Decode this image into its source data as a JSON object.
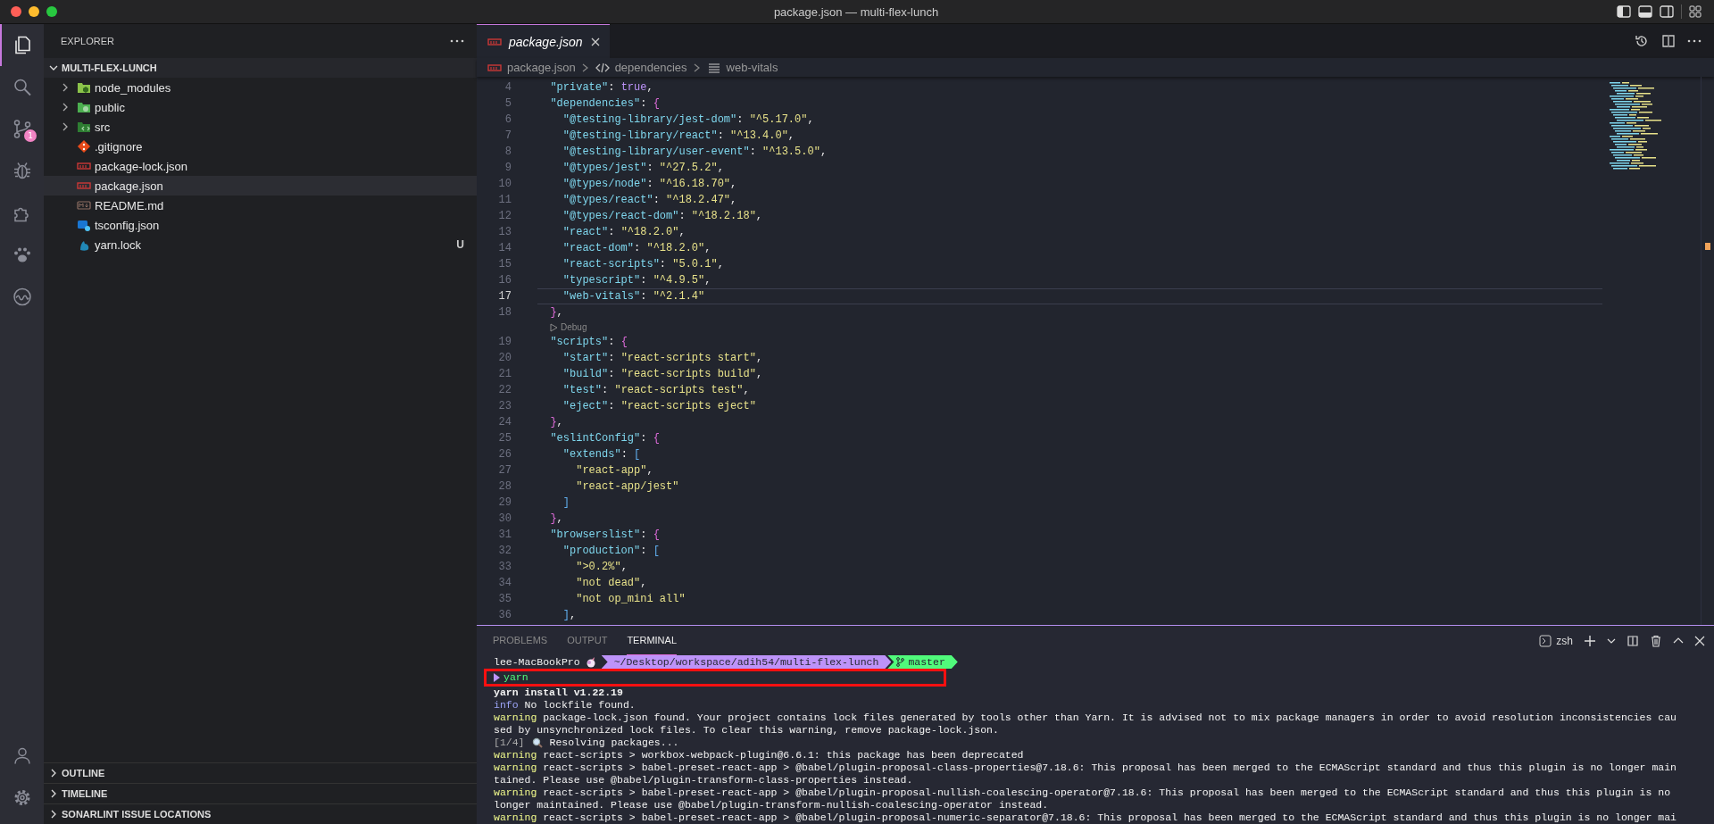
{
  "window": {
    "title": "package.json — multi-flex-lunch"
  },
  "activity_bar": {
    "items": [
      {
        "kind": "files",
        "selected": true
      },
      {
        "kind": "search",
        "selected": false
      },
      {
        "kind": "source-control",
        "selected": false,
        "badge": "1"
      },
      {
        "kind": "debug",
        "selected": false
      },
      {
        "kind": "extensions",
        "selected": false
      },
      {
        "kind": "paw",
        "selected": false
      },
      {
        "kind": "wave",
        "selected": false
      }
    ],
    "bottom": [
      {
        "kind": "account"
      },
      {
        "kind": "settings"
      }
    ]
  },
  "sidebar": {
    "title": "EXPLORER",
    "root": {
      "label": "MULTI-FLEX-LUNCH",
      "expanded": true,
      "children": [
        {
          "label": "node_modules",
          "kind": "folder-node",
          "expanded": false,
          "selected": false
        },
        {
          "label": "public",
          "kind": "folder-public",
          "expanded": false,
          "selected": false
        },
        {
          "label": "src",
          "kind": "folder-src",
          "expanded": false,
          "selected": false
        },
        {
          "label": ".gitignore",
          "kind": "git",
          "selected": false
        },
        {
          "label": "package-lock.json",
          "kind": "npm",
          "selected": false
        },
        {
          "label": "package.json",
          "kind": "npm",
          "selected": true
        },
        {
          "label": "README.md",
          "kind": "markdown",
          "selected": false
        },
        {
          "label": "tsconfig.json",
          "kind": "typescript",
          "selected": false
        },
        {
          "label": "yarn.lock",
          "kind": "yarn",
          "selected": false,
          "status": "U"
        }
      ]
    },
    "sections": [
      {
        "label": "OUTLINE",
        "expanded": false
      },
      {
        "label": "TIMELINE",
        "expanded": false
      },
      {
        "label": "SONARLINT ISSUE LOCATIONS",
        "expanded": false
      }
    ]
  },
  "editor": {
    "tabs": [
      {
        "label": "package.json",
        "selected": true,
        "preview": true
      }
    ],
    "breadcrumbs": [
      {
        "label": "package.json",
        "kind": "file"
      },
      {
        "label": "dependencies",
        "kind": "object"
      },
      {
        "label": "web-vitals",
        "kind": "property"
      }
    ],
    "lines": [
      {
        "kind": "code",
        "number": "4",
        "text": "  \"private\": true,",
        "current": false
      },
      {
        "kind": "code",
        "number": "5",
        "text": "  \"dependencies\": {",
        "current": false
      },
      {
        "kind": "code",
        "number": "6",
        "text": "    \"@testing-library/jest-dom\": \"^5.17.0\",",
        "current": false
      },
      {
        "kind": "code",
        "number": "7",
        "text": "    \"@testing-library/react\": \"^13.4.0\",",
        "current": false
      },
      {
        "kind": "code",
        "number": "8",
        "text": "    \"@testing-library/user-event\": \"^13.5.0\",",
        "current": false
      },
      {
        "kind": "code",
        "number": "9",
        "text": "    \"@types/jest\": \"^27.5.2\",",
        "current": false
      },
      {
        "kind": "code",
        "number": "10",
        "text": "    \"@types/node\": \"^16.18.70\",",
        "current": false
      },
      {
        "kind": "code",
        "number": "11",
        "text": "    \"@types/react\": \"^18.2.47\",",
        "current": false
      },
      {
        "kind": "code",
        "number": "12",
        "text": "    \"@types/react-dom\": \"^18.2.18\",",
        "current": false
      },
      {
        "kind": "code",
        "number": "13",
        "text": "    \"react\": \"^18.2.0\",",
        "current": false
      },
      {
        "kind": "code",
        "number": "14",
        "text": "    \"react-dom\": \"^18.2.0\",",
        "current": false
      },
      {
        "kind": "code",
        "number": "15",
        "text": "    \"react-scripts\": \"5.0.1\",",
        "current": false
      },
      {
        "kind": "code",
        "number": "16",
        "text": "    \"typescript\": \"^4.9.5\",",
        "current": false
      },
      {
        "kind": "code",
        "number": "17",
        "text": "    \"web-vitals\": \"^2.1.4\"",
        "current": true
      },
      {
        "kind": "code",
        "number": "18",
        "text": "  },",
        "current": false
      },
      {
        "kind": "lens",
        "text": "Debug"
      },
      {
        "kind": "code",
        "number": "19",
        "text": "  \"scripts\": {",
        "current": false
      },
      {
        "kind": "code",
        "number": "20",
        "text": "    \"start\": \"react-scripts start\",",
        "current": false
      },
      {
        "kind": "code",
        "number": "21",
        "text": "    \"build\": \"react-scripts build\",",
        "current": false
      },
      {
        "kind": "code",
        "number": "22",
        "text": "    \"test\": \"react-scripts test\",",
        "current": false
      },
      {
        "kind": "code",
        "number": "23",
        "text": "    \"eject\": \"react-scripts eject\"",
        "current": false
      },
      {
        "kind": "code",
        "number": "24",
        "text": "  },",
        "current": false
      },
      {
        "kind": "code",
        "number": "25",
        "text": "  \"eslintConfig\": {",
        "current": false
      },
      {
        "kind": "code",
        "number": "26",
        "text": "    \"extends\": [",
        "current": false
      },
      {
        "kind": "code",
        "number": "27",
        "text": "      \"react-app\",",
        "current": false
      },
      {
        "kind": "code",
        "number": "28",
        "text": "      \"react-app/jest\"",
        "current": false
      },
      {
        "kind": "code",
        "number": "29",
        "text": "    ]",
        "current": false
      },
      {
        "kind": "code",
        "number": "30",
        "text": "  },",
        "current": false
      },
      {
        "kind": "code",
        "number": "31",
        "text": "  \"browserslist\": {",
        "current": false
      },
      {
        "kind": "code",
        "number": "32",
        "text": "    \"production\": [",
        "current": false
      },
      {
        "kind": "code",
        "number": "33",
        "text": "      \">0.2%\",",
        "current": false
      },
      {
        "kind": "code",
        "number": "34",
        "text": "      \"not dead\",",
        "current": false
      },
      {
        "kind": "code",
        "number": "35",
        "text": "      \"not op_mini all\"",
        "current": false
      },
      {
        "kind": "code",
        "number": "36",
        "text": "    ],",
        "current": false
      }
    ]
  },
  "panel": {
    "tabs": [
      {
        "label": "PROBLEMS",
        "selected": false
      },
      {
        "label": "OUTPUT",
        "selected": false
      },
      {
        "label": "TERMINAL",
        "selected": true
      }
    ],
    "shell": "zsh",
    "terminal": {
      "prompt": {
        "host": "lee-MacBookPro",
        "path": "~/Desktop/workspace/adih54/multi-flex-lunch",
        "branch": "master"
      },
      "lines": [
        {
          "kind": "command",
          "text": "yarn",
          "boxed": true
        },
        {
          "kind": "title",
          "text": "yarn install v1.22.19",
          "boxed": false
        },
        {
          "kind": "log",
          "tag": "info",
          "text": "No lockfile found.",
          "boxed": false
        },
        {
          "kind": "log",
          "tag": "warning",
          "text": "package-lock.json found. Your project contains lock files generated by tools other than Yarn. It is advised not to mix package managers in order to avoid resolution inconsistencies cau",
          "boxed": false
        },
        {
          "kind": "plain",
          "text": "sed by unsynchronized lock files. To clear this warning, remove package-lock.json.",
          "boxed": false
        },
        {
          "kind": "step",
          "step": "[1/4]",
          "text": "Resolving packages...",
          "boxed": false
        },
        {
          "kind": "log",
          "tag": "warning",
          "text": "react-scripts > workbox-webpack-plugin@6.6.1: this package has been deprecated",
          "boxed": false
        },
        {
          "kind": "log",
          "tag": "warning",
          "text": "react-scripts > babel-preset-react-app > @babel/plugin-proposal-class-properties@7.18.6: This proposal has been merged to the ECMAScript standard and thus this plugin is no longer main",
          "boxed": false
        },
        {
          "kind": "plain",
          "text": "tained. Please use @babel/plugin-transform-class-properties instead.",
          "boxed": false
        },
        {
          "kind": "log",
          "tag": "warning",
          "text": "react-scripts > babel-preset-react-app > @babel/plugin-proposal-nullish-coalescing-operator@7.18.6: This proposal has been merged to the ECMAScript standard and thus this plugin is no",
          "boxed": false
        },
        {
          "kind": "plain",
          "text": "longer maintained. Please use @babel/plugin-transform-nullish-coalescing-operator instead.",
          "boxed": false
        },
        {
          "kind": "log",
          "tag": "warning",
          "text": "react-scripts > babel-preset-react-app > @babel/plugin-proposal-numeric-separator@7.18.6: This proposal has been merged to the ECMAScript standard and thus this plugin is no longer mai",
          "boxed": false
        }
      ]
    }
  }
}
